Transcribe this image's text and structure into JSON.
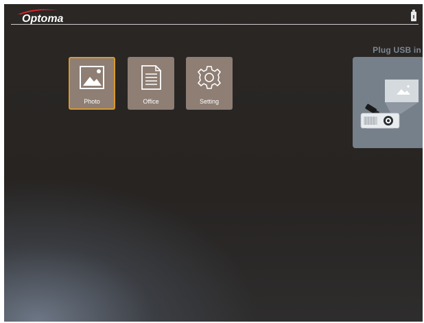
{
  "brand": {
    "logo_text": "Optoma",
    "accent_color": "#e0262c"
  },
  "status": {
    "usb_icon": "usb-drive-icon"
  },
  "menu": {
    "items": [
      {
        "label": "Photo",
        "icon": "photo-icon",
        "selected": true
      },
      {
        "label": "Office",
        "icon": "document-icon",
        "selected": false
      },
      {
        "label": "Setting",
        "icon": "gear-icon",
        "selected": false
      }
    ],
    "tile_color": "#8e7e73",
    "selected_border_color": "#d89a2c"
  },
  "usb_prompt": {
    "title": "Plug USB in",
    "illustration_icon": "projector-with-usb-icon",
    "panel_color": "#76808a"
  }
}
